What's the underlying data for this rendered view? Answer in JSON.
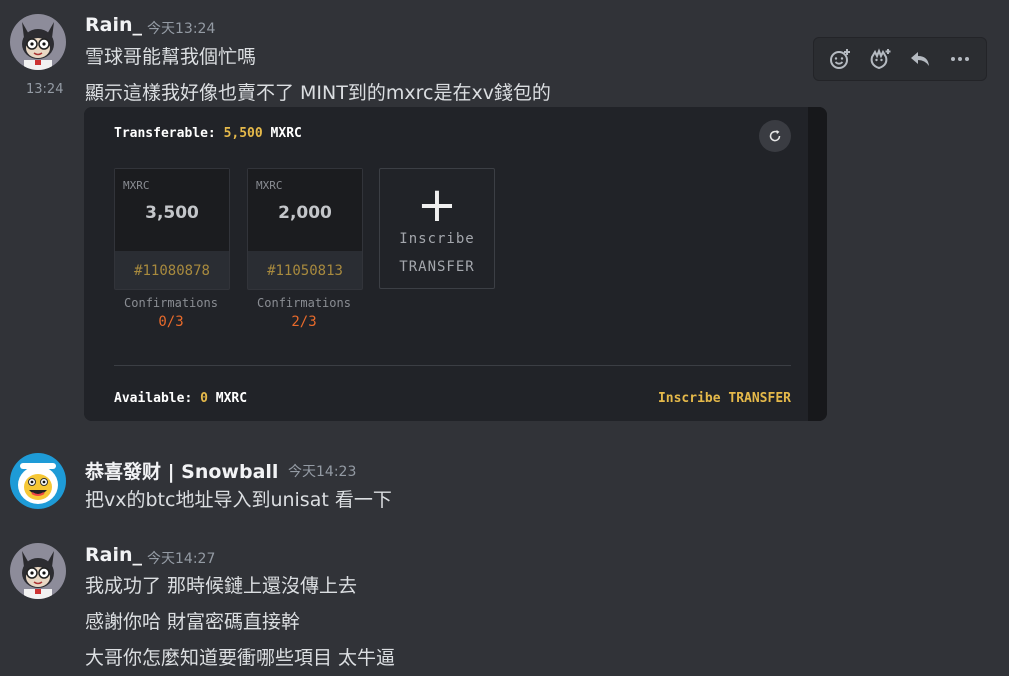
{
  "messages": [
    {
      "author": "Rain_",
      "timestamp": "今天13:24",
      "lines": [
        "雪球哥能幫我個忙嗎"
      ]
    },
    {
      "side_timestamp": "13:24",
      "lines": [
        "顯示這樣我好像也賣不了 MINT到的mxrc是在xv錢包的"
      ]
    },
    {
      "author": "恭喜發财 | Snowball",
      "timestamp": "今天14:23",
      "lines": [
        "把vx的btc地址导入到unisat 看一下"
      ]
    },
    {
      "author": "Rain_",
      "timestamp": "今天14:27",
      "lines": [
        "我成功了 那時候鏈上還沒傳上去",
        "感謝你哈 財富密碼直接幹",
        "大哥你怎麼知道要衝哪些項目 太牛逼"
      ]
    }
  ],
  "toolbar": {
    "icons": [
      "add-reaction-icon",
      "super-reaction-icon",
      "reply-icon",
      "more-icon"
    ]
  },
  "embed": {
    "transferable_label": "Transferable:",
    "transferable_value": "5,500",
    "transferable_unit": "MXRC",
    "cards": [
      {
        "tick": "MXRC",
        "amount": "3,500",
        "inscription": "#11080878",
        "conf_label": "Confirmations",
        "conf_value": "0/3"
      },
      {
        "tick": "MXRC",
        "amount": "2,000",
        "inscription": "#11050813",
        "conf_label": "Confirmations",
        "conf_value": "2/3"
      }
    ],
    "inscribe_card": {
      "plus": "+",
      "line1": "Inscribe",
      "line2": "TRANSFER"
    },
    "available_label": "Available:",
    "available_value": "0",
    "available_unit": "MXRC",
    "inscribe_link": "Inscribe TRANSFER"
  },
  "colors": {
    "background": "#313338",
    "gold": "#e5b94a",
    "orange": "#e86a2b"
  }
}
